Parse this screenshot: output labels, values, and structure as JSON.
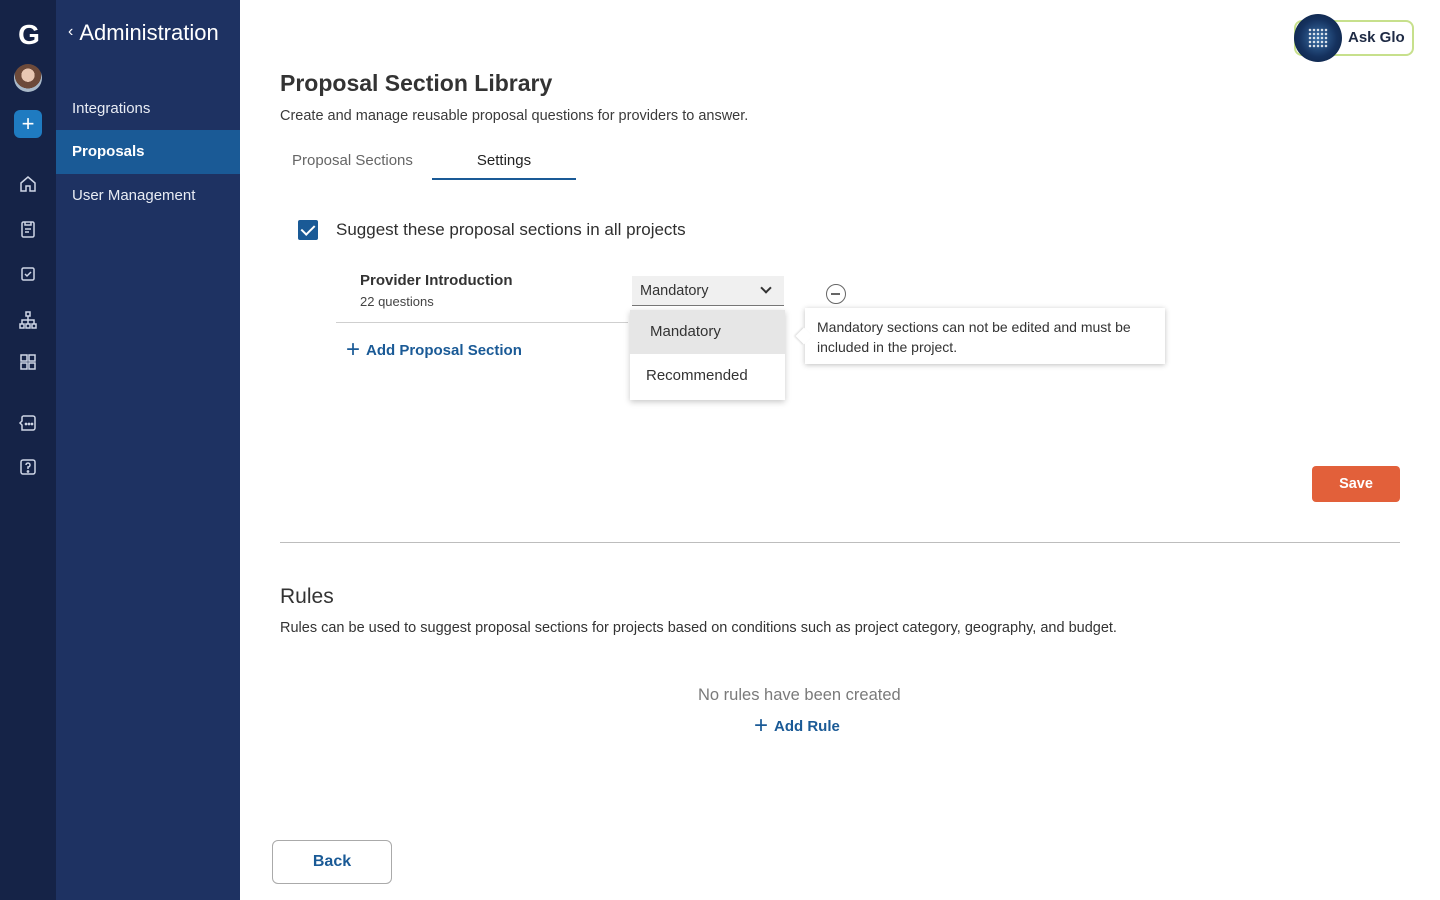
{
  "rail": {
    "logo": "G",
    "plus": "+",
    "icons": [
      "home-icon",
      "clipboard-icon",
      "checkbox-icon",
      "org-chart-icon",
      "grid-icon",
      "chat-icon",
      "help-icon"
    ]
  },
  "nav": {
    "title": "Administration",
    "items": [
      {
        "label": "Integrations",
        "active": false
      },
      {
        "label": "Proposals",
        "active": true
      },
      {
        "label": "User Management",
        "active": false
      }
    ]
  },
  "ask_glo": {
    "label": "Ask Glo"
  },
  "page": {
    "title": "Proposal Section Library",
    "subtitle": "Create and manage reusable proposal questions for providers to answer."
  },
  "tabs": [
    {
      "label": "Proposal Sections",
      "active": false
    },
    {
      "label": "Settings",
      "active": true
    }
  ],
  "settings": {
    "checkbox_label": "Suggest these proposal sections in all projects",
    "checked": true,
    "section": {
      "name": "Provider Introduction",
      "count": "22 questions"
    },
    "select": {
      "value": "Mandatory",
      "options": [
        "Mandatory",
        "Recommended"
      ]
    },
    "tooltip": "Mandatory sections can not be edited and must be included in the project.",
    "add_section_label": "Add Proposal Section",
    "save_label": "Save"
  },
  "rules": {
    "title": "Rules",
    "subtitle": "Rules can be used to suggest proposal sections for projects based on conditions such as project category, geography, and budget.",
    "empty_text": "No rules have been created",
    "add_rule_label": "Add Rule"
  },
  "footer": {
    "back_label": "Back"
  },
  "colors": {
    "rail": "#152347",
    "nav": "#1e3262",
    "nav_active": "#1a5a96",
    "accent": "#1a5a96",
    "save": "#e2603a"
  }
}
